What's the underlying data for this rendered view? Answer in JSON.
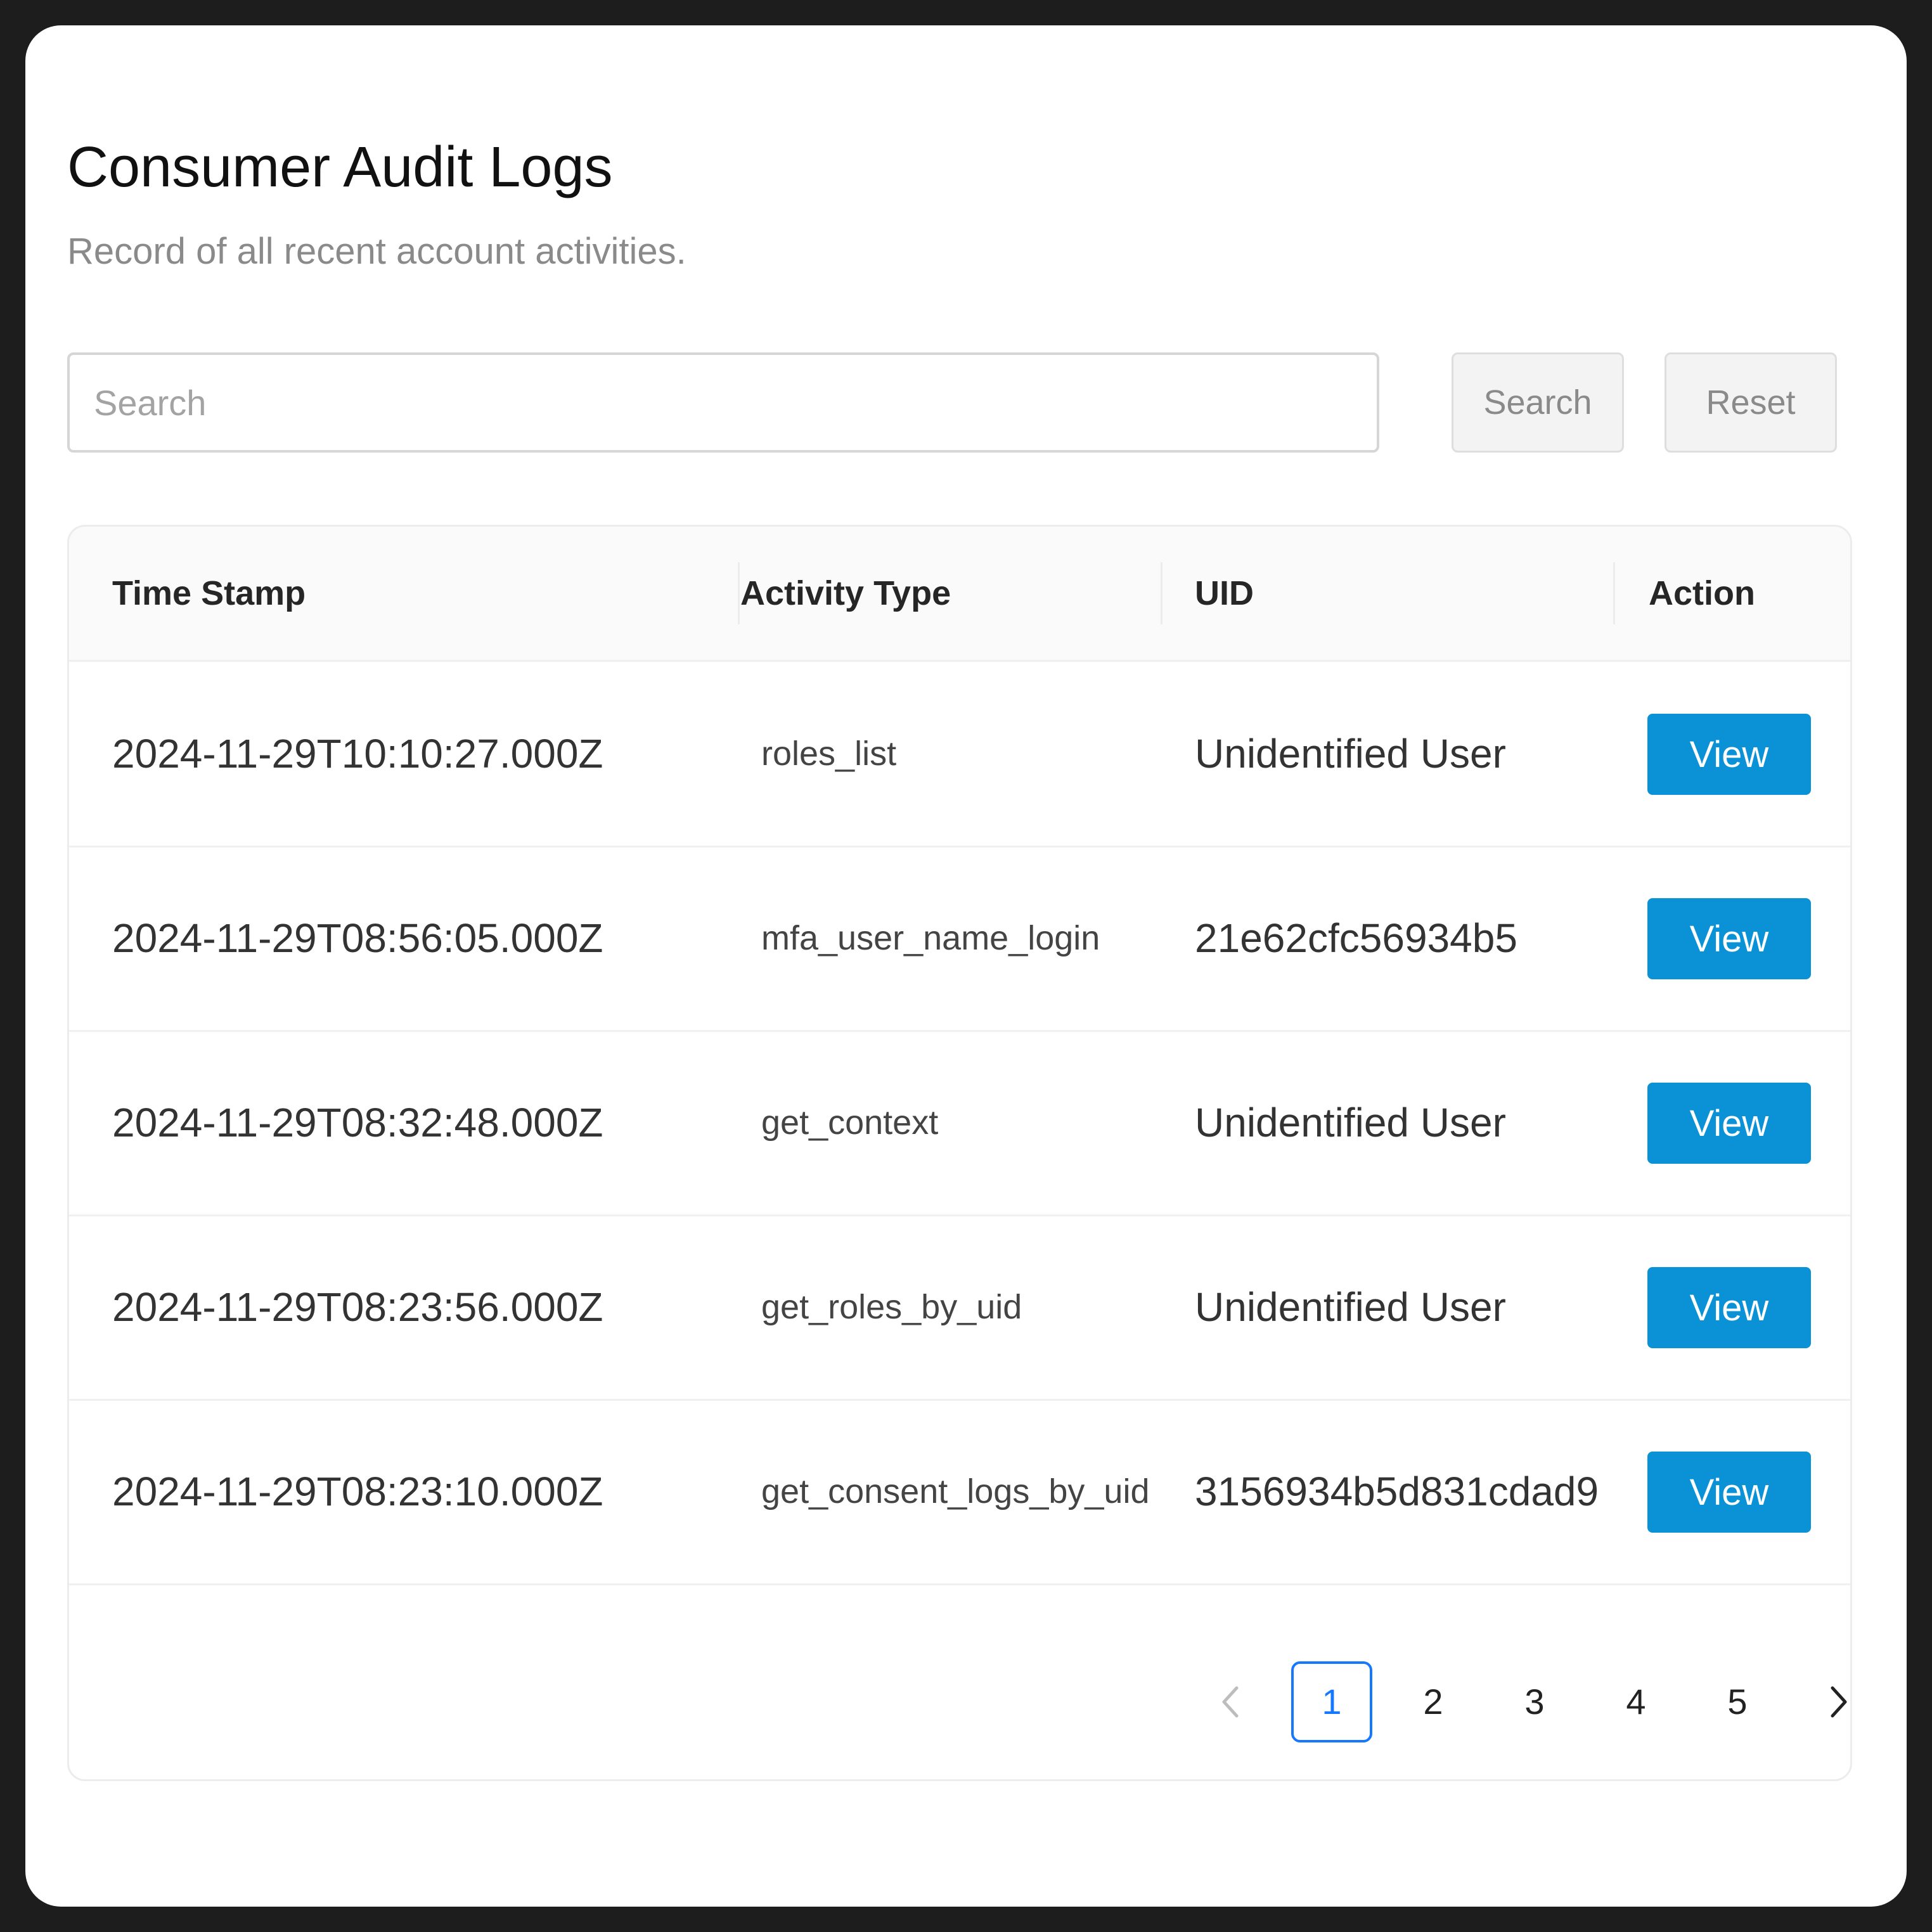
{
  "header": {
    "title": "Consumer Audit Logs",
    "subtitle": "Record of all recent account activities."
  },
  "search": {
    "placeholder": "Search",
    "value": "",
    "search_label": "Search",
    "reset_label": "Reset"
  },
  "table": {
    "columns": [
      "Time Stamp",
      "Activity Type",
      "UID",
      "Action"
    ],
    "rows": [
      {
        "timestamp": "2024-11-29T10:10:27.000Z",
        "activity": "roles_list",
        "uid": "Unidentified User",
        "action": "View"
      },
      {
        "timestamp": "2024-11-29T08:56:05.000Z",
        "activity": "mfa_user_name_login",
        "uid": "21e62cfc56934b5",
        "action": "View"
      },
      {
        "timestamp": "2024-11-29T08:32:48.000Z",
        "activity": "get_context",
        "uid": "Unidentified User",
        "action": "View"
      },
      {
        "timestamp": "2024-11-29T08:23:56.000Z",
        "activity": "get_roles_by_uid",
        "uid": "Unidentified User",
        "action": "View"
      },
      {
        "timestamp": "2024-11-29T08:23:10.000Z",
        "activity": "get_consent_logs_by_uid",
        "uid": "3156934b5d831cdad9",
        "action": "View"
      }
    ]
  },
  "pagination": {
    "pages": [
      "1",
      "2",
      "3",
      "4",
      "5"
    ],
    "current": "1",
    "prev_icon": "chevron-left-icon",
    "next_icon": "chevron-right-icon"
  },
  "colors": {
    "primary_button": "#0a91d6",
    "active_page": "#1677ff"
  }
}
